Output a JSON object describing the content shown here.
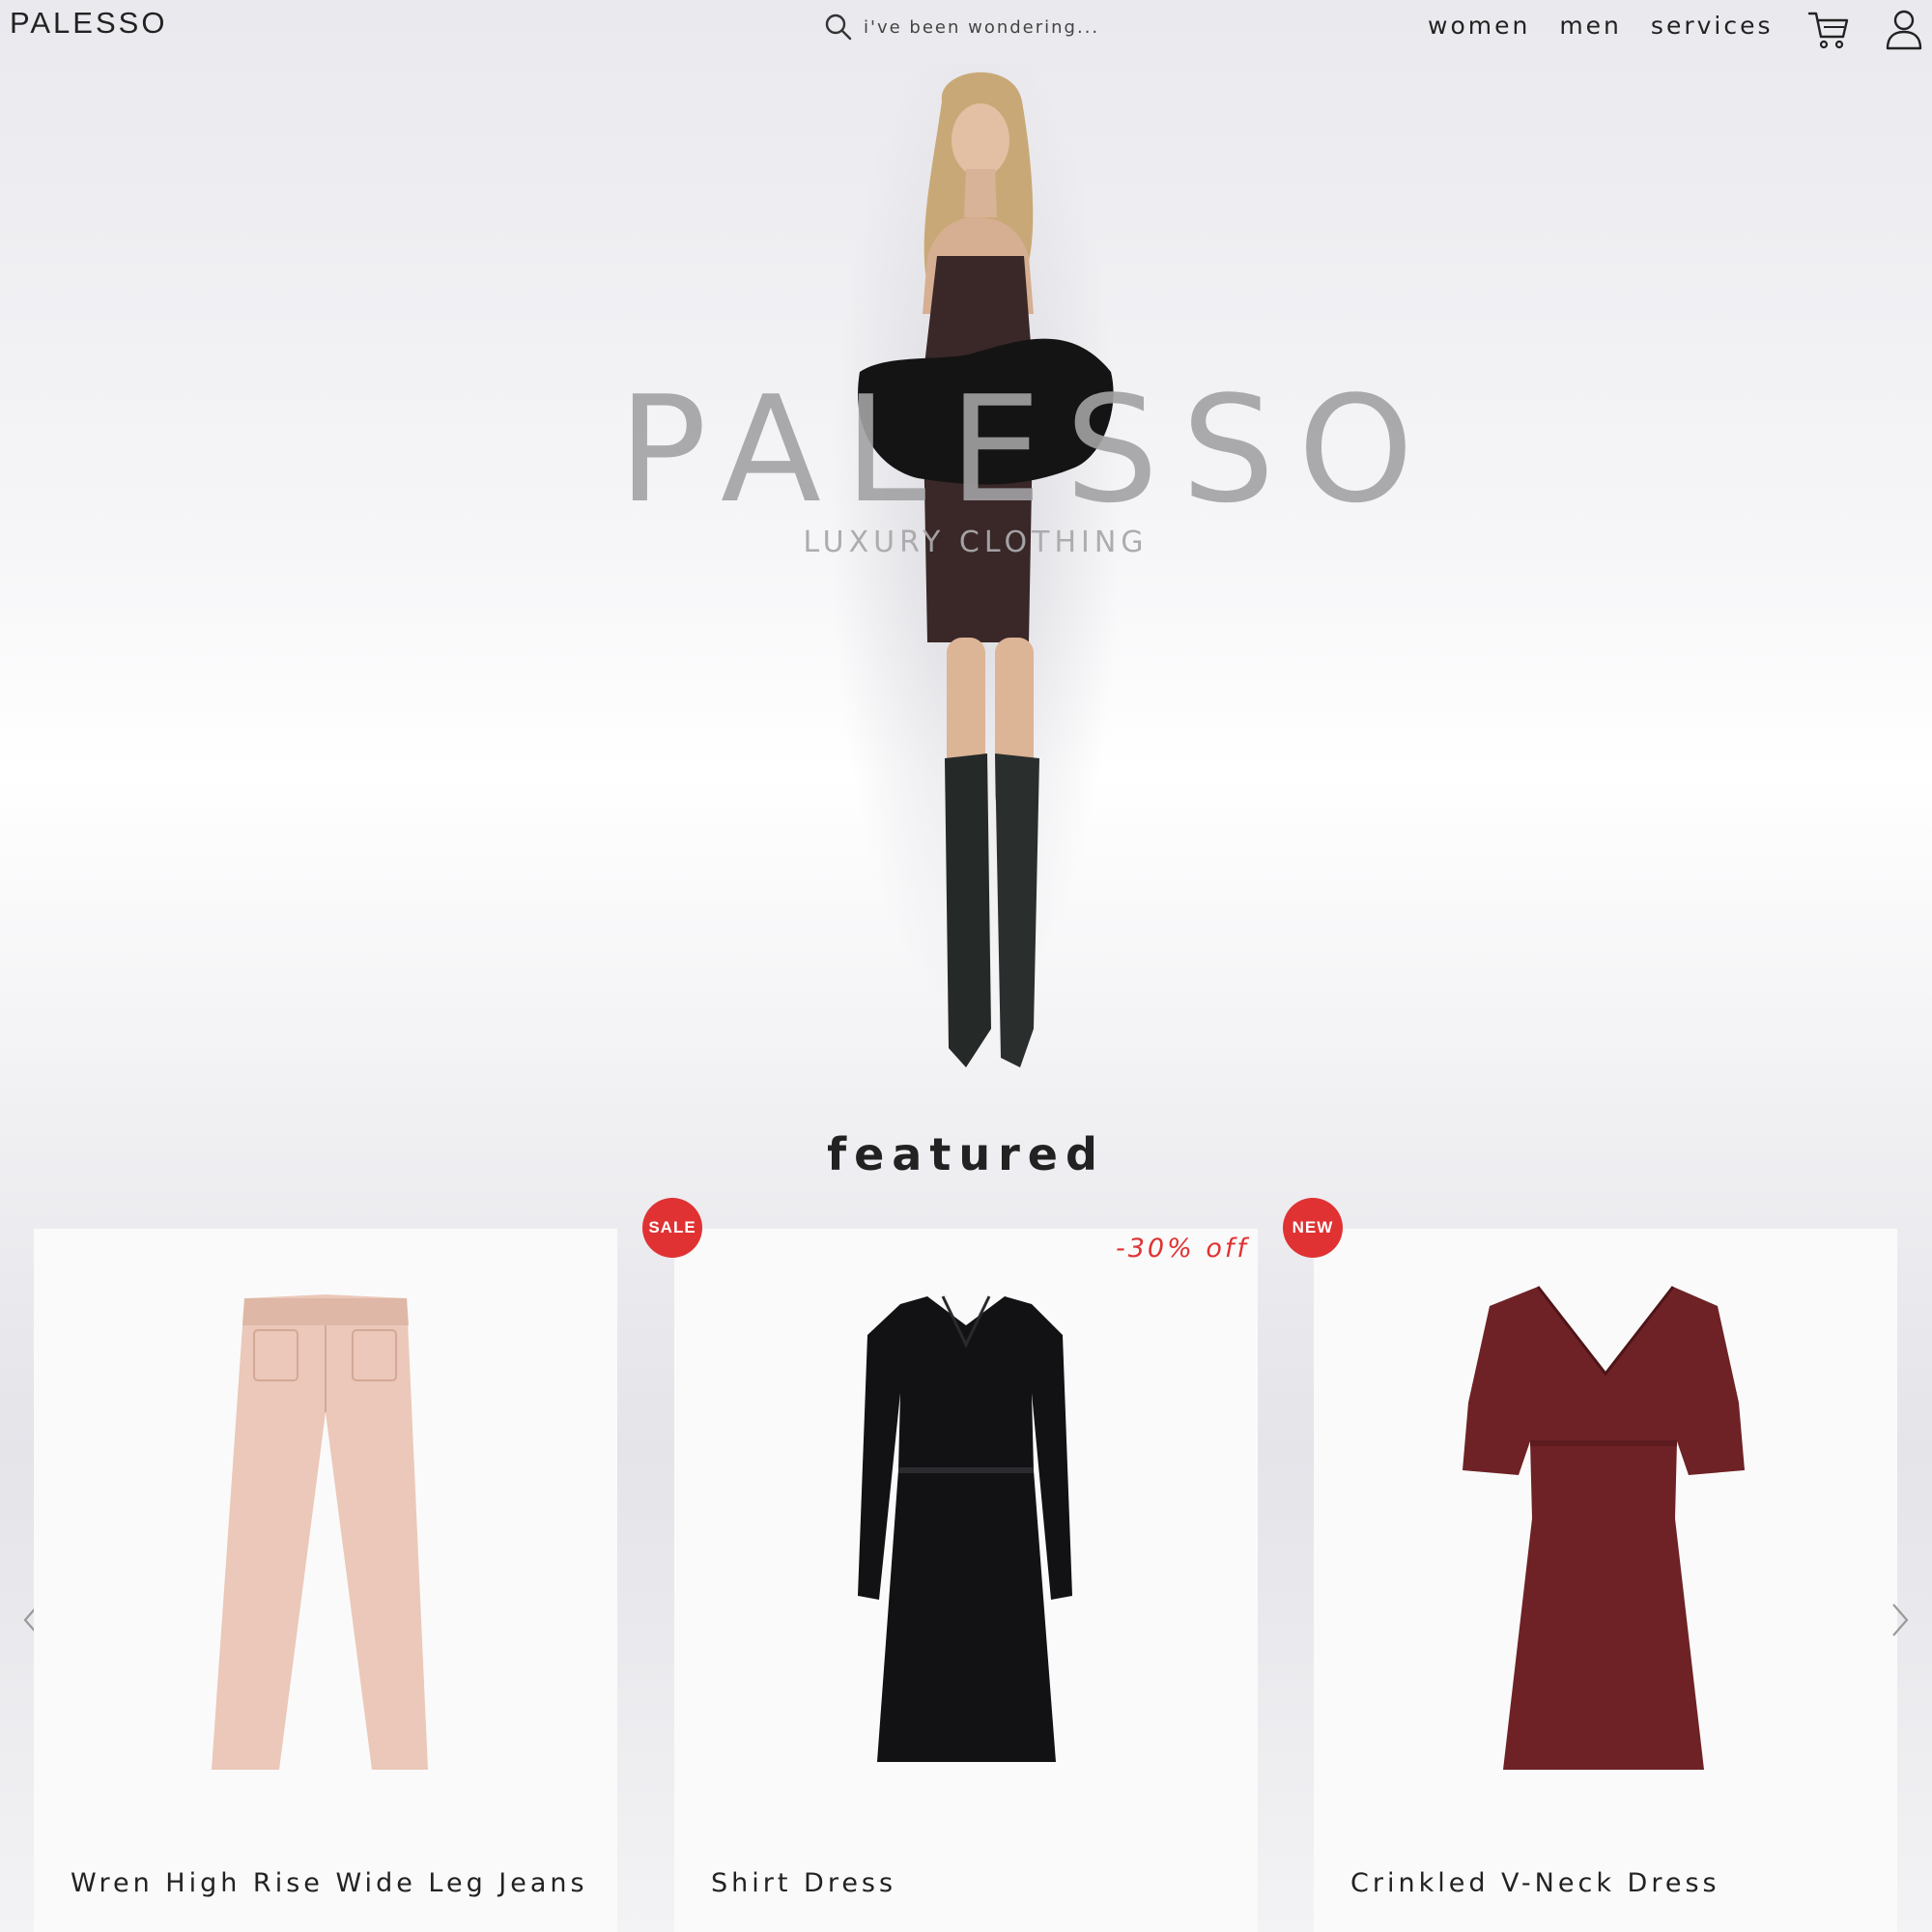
{
  "header": {
    "brand": "PALESSO",
    "search": {
      "placeholder": "i've been wondering..."
    },
    "nav": [
      "women",
      "men",
      "services"
    ],
    "icons": [
      "search-icon",
      "cart-icon",
      "user-icon"
    ]
  },
  "hero": {
    "title": "PALESSO",
    "subtitle": "LUXURY CLOTHING"
  },
  "featured": {
    "heading": "featured",
    "products": [
      {
        "name": "Wren High Rise Wide Leg Jeans",
        "badge": "",
        "discount": ""
      },
      {
        "name": "Shirt Dress",
        "badge": "SALE",
        "discount": "-30% off"
      },
      {
        "name": "Crinkled V-Neck Dress",
        "badge": "NEW",
        "discount": ""
      }
    ]
  },
  "colors": {
    "accent": "#e03233",
    "text": "#222222",
    "hero_text": "#a2a2a4"
  }
}
